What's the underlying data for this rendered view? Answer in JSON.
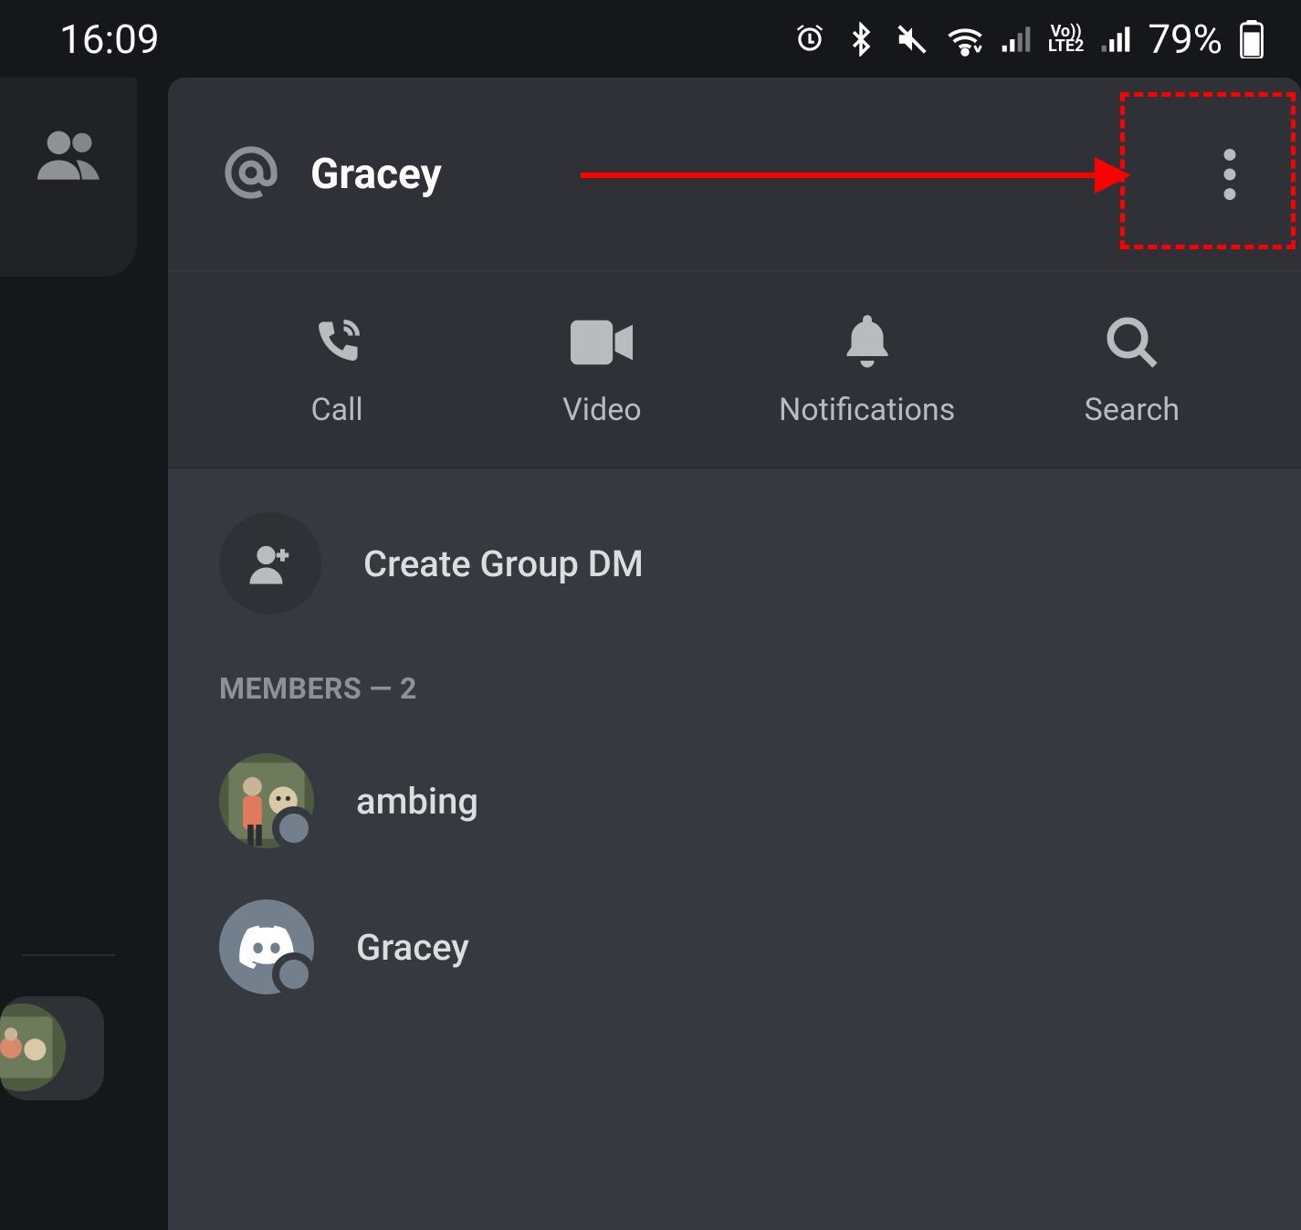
{
  "statusbar": {
    "time": "16:09",
    "battery_pct": "79%",
    "network_label_line1": "Vo))",
    "network_label_line2": "LTE2"
  },
  "panel": {
    "title": "Gracey"
  },
  "actions": {
    "call": "Call",
    "video": "Video",
    "notifications": "Notifications",
    "search": "Search"
  },
  "create_group": {
    "label": "Create Group DM"
  },
  "members_section": {
    "header": "MEMBERS — 2",
    "items": [
      {
        "name": "ambing"
      },
      {
        "name": "Gracey"
      }
    ]
  }
}
